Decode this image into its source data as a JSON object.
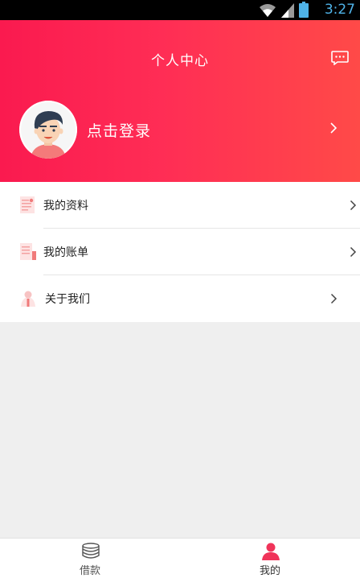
{
  "status_bar": {
    "time": "3:27"
  },
  "header": {
    "title": "个人中心"
  },
  "profile": {
    "login_label": "点击登录"
  },
  "menu": {
    "items": [
      {
        "label": "我的资料",
        "icon": "profile-doc-icon"
      },
      {
        "label": "我的账单",
        "icon": "bill-icon"
      },
      {
        "label": "关于我们",
        "icon": "about-icon"
      }
    ]
  },
  "tabbar": {
    "tabs": [
      {
        "label": "借款",
        "icon": "coins-stack-icon",
        "active": false
      },
      {
        "label": "我的",
        "icon": "user-icon",
        "active": true
      }
    ]
  },
  "colors": {
    "header_start": "#fa1a4f",
    "header_end": "#ff4a48",
    "active_tab": "#f0345a",
    "inactive_tab": "#555555",
    "status_time": "#4fb3e8"
  }
}
